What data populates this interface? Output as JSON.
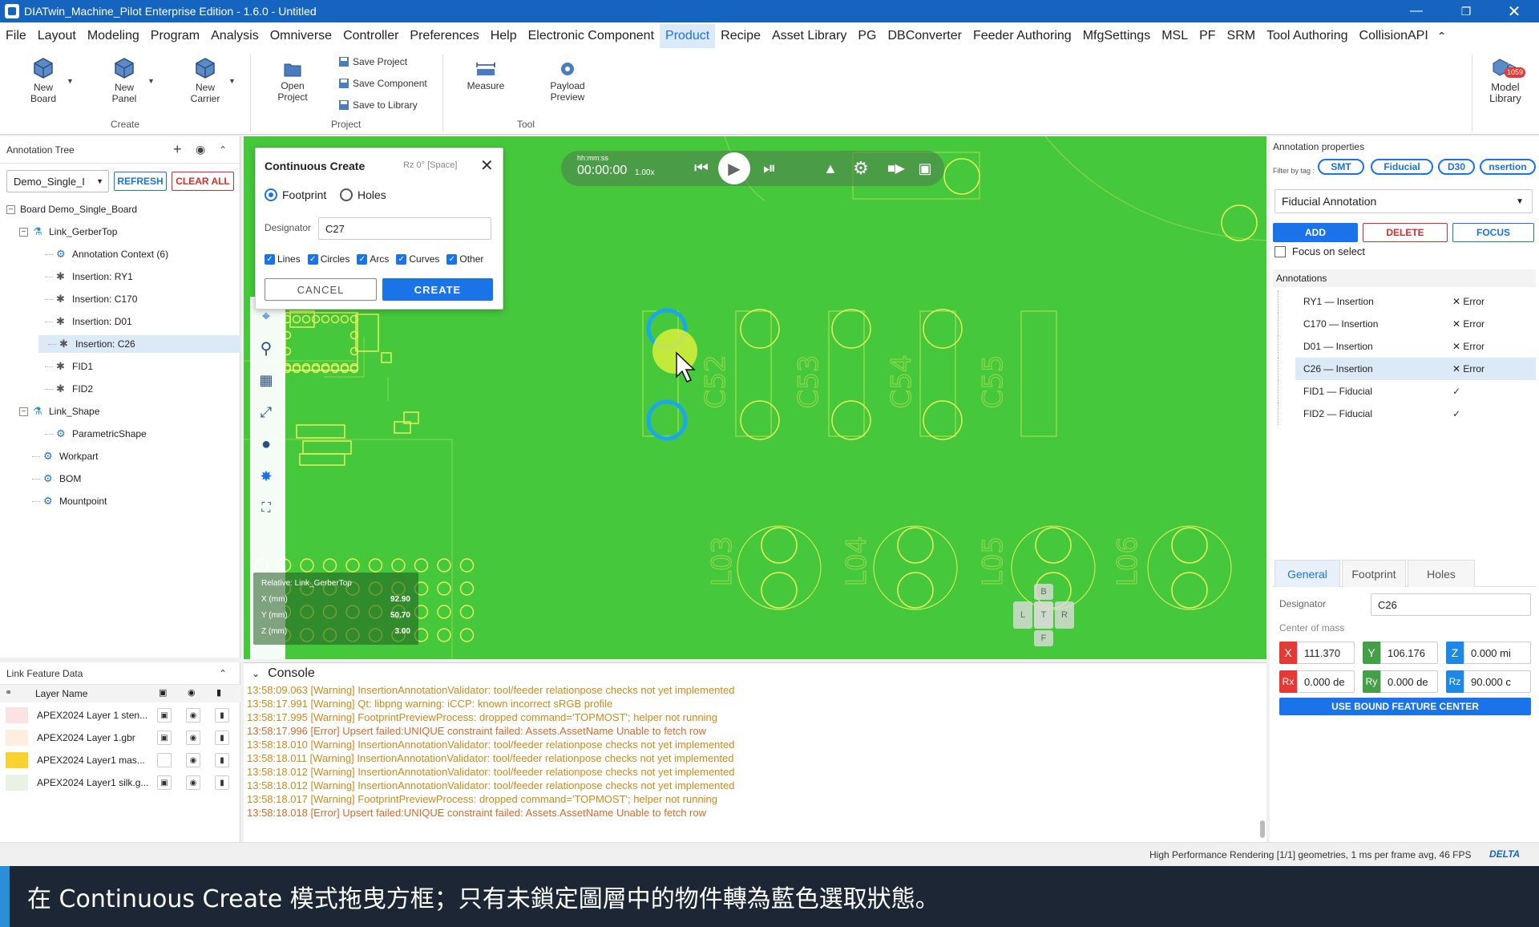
{
  "window": {
    "title": "DIATwin_Machine_Pilot Enterprise Edition - 1.6.0 - Untitled",
    "controls": [
      "minimize-icon",
      "restore-icon",
      "close-icon"
    ]
  },
  "menu": {
    "items": [
      "File",
      "Layout",
      "Modeling",
      "Program",
      "Analysis",
      "Omniverse",
      "Controller",
      "Preferences",
      "Help",
      "Electronic Component",
      "Product",
      "Recipe",
      "Asset Library",
      "PG",
      "DBConverter",
      "Feeder Authoring",
      "MfgSettings",
      "MSL",
      "PF",
      "SRM",
      "Tool Authoring",
      "CollisionAPI"
    ],
    "active": "Product"
  },
  "ribbon": {
    "new_board": "New\nBoard",
    "new_panel": "New\nPanel",
    "new_carrier": "New\nCarrier",
    "group_create": "Create",
    "open_project": "Open\nProject",
    "save_project": "Save Project",
    "save_component": "Save Component",
    "save_to_library": "Save to Library",
    "group_project": "Project",
    "measure": "Measure",
    "payload_preview": "Payload\nPreview",
    "group_tool": "Tool",
    "model_library": "Model\nLibrary",
    "model_library_badge": "1059"
  },
  "tree": {
    "title": "Annotation Tree",
    "board_select": "Demo_Single_I",
    "refresh": "REFRESH",
    "clear_all": "CLEAR ALL",
    "nodes": [
      {
        "label": "Board  Demo_Single_Board"
      },
      {
        "label": "Link_GerberTop"
      },
      {
        "label": "Annotation Context (6)"
      },
      {
        "label": "Insertion: RY1"
      },
      {
        "label": "Insertion: C170"
      },
      {
        "label": "Insertion: D01"
      },
      {
        "label": "Insertion: C26"
      },
      {
        "label": "FID1"
      },
      {
        "label": "FID2"
      },
      {
        "label": "Link_Shape"
      },
      {
        "label": "ParametricShape"
      },
      {
        "label": "Workpart"
      },
      {
        "label": "BOM"
      },
      {
        "label": "Mountpoint"
      }
    ]
  },
  "link_feature": {
    "title": "Link Feature Data",
    "col_layer": "Layer Name",
    "layers": [
      {
        "name": "APEX2024 Layer 1 sten...",
        "color": "#fbe3e3",
        "locked": true
      },
      {
        "name": "APEX2024 Layer 1.gbr",
        "color": "#fdeee0",
        "locked": true
      },
      {
        "name": "APEX2024 Layer1 mas...",
        "color": "#f9d230",
        "locked": false
      },
      {
        "name": "APEX2024 Layer1 silk.g...",
        "color": "#e8f3e6",
        "locked": true
      }
    ]
  },
  "dialog": {
    "title": "Continuous Create",
    "hint": "Rz 0° [Space]",
    "opt_footprint": "Footprint",
    "opt_holes": "Holes",
    "designator_label": "Designator",
    "designator_value": "C27",
    "filters": [
      "Lines",
      "Circles",
      "Arcs",
      "Curves",
      "Other"
    ],
    "cancel": "CANCEL",
    "create": "CREATE"
  },
  "playback": {
    "time_label": "hh:mm:ss",
    "time": "00:00:00",
    "speed": "1.00x"
  },
  "coords": {
    "relative": "Relative: Link_GerberTop",
    "x_label": "X (mm)",
    "x": "92.90",
    "y_label": "Y (mm)",
    "y": "50.70",
    "z_label": "Z (mm)",
    "z": "3.00"
  },
  "silk": [
    "C52",
    "C53",
    "C54",
    "C55",
    "L03",
    "L04",
    "L05",
    "L06"
  ],
  "navcube": {
    "b": "B",
    "l": "L",
    "t": "T",
    "r": "R",
    "f": "F"
  },
  "props": {
    "title": "Annotation properties",
    "filter_label": "Filter by tag :",
    "tags": [
      "SMT",
      "Fiducial",
      "D30",
      "nsertion"
    ],
    "type_select": "Fiducial Annotation",
    "add": "ADD",
    "delete": "DELETE",
    "focus": "FOCUS",
    "focus_on_select": "Focus on select",
    "annotations_title": "Annotations",
    "annotations": [
      {
        "name": "RY1 — Insertion",
        "status": "✕ Error"
      },
      {
        "name": "C170 — Insertion",
        "status": "✕ Error"
      },
      {
        "name": "D01 — Insertion",
        "status": "✕ Error"
      },
      {
        "name": "C26 — Insertion",
        "status": "✕ Error"
      },
      {
        "name": "FID1 — Fiducial",
        "status": "✓"
      },
      {
        "name": "FID2 — Fiducial",
        "status": "✓"
      }
    ],
    "tabs": [
      "General",
      "Footprint",
      "Holes"
    ],
    "designator_label": "Designator",
    "designator": "C26",
    "center_label": "Center of mass",
    "x_tag": "X",
    "x": "111.370",
    "y_tag": "Y",
    "y": "106.176",
    "z_tag": "Z",
    "z": "0.000 mi",
    "rx_tag": "Rx",
    "rx": "0.000 de",
    "ry_tag": "Ry",
    "ry": "0.000 de",
    "rz_tag": "Rz",
    "rz": "90.000 c",
    "use_bound": "USE BOUND FEATURE CENTER"
  },
  "console": {
    "title": "Console",
    "lines": [
      {
        "t": "13:58:09.063 [Warning] InsertionAnnotationValidator: tool/feeder relationpose checks not yet implemented",
        "err": false
      },
      {
        "t": "13:58:17.991 [Warning] Qt: libpng warning: iCCP: known incorrect sRGB profile",
        "err": false
      },
      {
        "t": "13:58:17.995 [Warning] FootprintPreviewProcess: dropped command='TOPMOST'; helper not running",
        "err": false
      },
      {
        "t": "13:58:17.996 [Error] Upsert failed:UNIQUE constraint failed: Assets.AssetName Unable to fetch row",
        "err": true
      },
      {
        "t": "13:58:18.010 [Warning] InsertionAnnotationValidator: tool/feeder relationpose checks not yet implemented",
        "err": false
      },
      {
        "t": "13:58:18.011 [Warning] InsertionAnnotationValidator: tool/feeder relationpose checks not yet implemented",
        "err": false
      },
      {
        "t": "13:58:18.012 [Warning] InsertionAnnotationValidator: tool/feeder relationpose checks not yet implemented",
        "err": false
      },
      {
        "t": "13:58:18.012 [Warning] InsertionAnnotationValidator: tool/feeder relationpose checks not yet implemented",
        "err": false
      },
      {
        "t": "13:58:18.017 [Warning] FootprintPreviewProcess: dropped command='TOPMOST'; helper not running",
        "err": false
      },
      {
        "t": "13:58:18.018 [Error] Upsert failed:UNIQUE constraint failed: Assets.AssetName Unable to fetch row",
        "err": true
      }
    ]
  },
  "status": {
    "text": "High Performance Rendering [1/1] geometries, 1 ms per frame avg, 46 FPS",
    "brand": "DELTA"
  },
  "caption": "在 Continuous Create 模式拖曳方框；只有未鎖定圖層中的物件轉為藍色選取狀態。",
  "colors": {
    "accent": "#1a73e8",
    "pcb": "#45c83c",
    "pad": "#e6f05a",
    "danger": "#d32f2f",
    "warning_text": "#d08a1a"
  }
}
